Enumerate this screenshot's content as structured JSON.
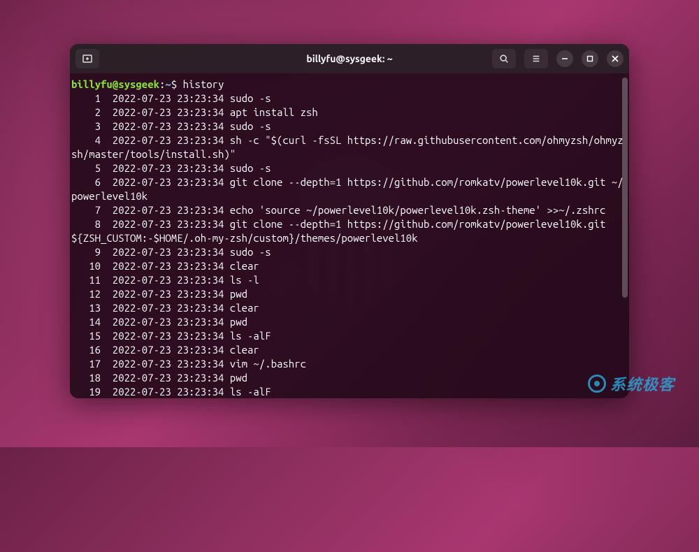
{
  "titlebar": {
    "title": "billyfu@sysgeek: ~"
  },
  "prompt": {
    "user_host": "billyfu@sysgeek",
    "colon": ":",
    "path": "~",
    "dollar": "$",
    "command": "history"
  },
  "history": [
    {
      "n": "1",
      "ts": "2022-07-23 23:23:34",
      "cmd": "sudo -s"
    },
    {
      "n": "2",
      "ts": "2022-07-23 23:23:34",
      "cmd": "apt install zsh"
    },
    {
      "n": "3",
      "ts": "2022-07-23 23:23:34",
      "cmd": "sudo -s"
    },
    {
      "n": "4",
      "ts": "2022-07-23 23:23:34",
      "cmd": "sh -c \"$(curl -fsSL https://raw.githubusercontent.com/ohmyzsh/ohmyzsh/master/tools/install.sh)\""
    },
    {
      "n": "5",
      "ts": "2022-07-23 23:23:34",
      "cmd": "sudo -s"
    },
    {
      "n": "6",
      "ts": "2022-07-23 23:23:34",
      "cmd": "git clone --depth=1 https://github.com/romkatv/powerlevel10k.git ~/powerlevel10k"
    },
    {
      "n": "7",
      "ts": "2022-07-23 23:23:34",
      "cmd": "echo 'source ~/powerlevel10k/powerlevel10k.zsh-theme' >>~/.zshrc"
    },
    {
      "n": "8",
      "ts": "2022-07-23 23:23:34",
      "cmd": "git clone --depth=1 https://github.com/romkatv/powerlevel10k.git ${ZSH_CUSTOM:-$HOME/.oh-my-zsh/custom}/themes/powerlevel10k"
    },
    {
      "n": "9",
      "ts": "2022-07-23 23:23:34",
      "cmd": "sudo -s"
    },
    {
      "n": "10",
      "ts": "2022-07-23 23:23:34",
      "cmd": "clear"
    },
    {
      "n": "11",
      "ts": "2022-07-23 23:23:34",
      "cmd": "ls -l"
    },
    {
      "n": "12",
      "ts": "2022-07-23 23:23:34",
      "cmd": "pwd"
    },
    {
      "n": "13",
      "ts": "2022-07-23 23:23:34",
      "cmd": "clear"
    },
    {
      "n": "14",
      "ts": "2022-07-23 23:23:34",
      "cmd": "pwd"
    },
    {
      "n": "15",
      "ts": "2022-07-23 23:23:34",
      "cmd": "ls -alF"
    },
    {
      "n": "16",
      "ts": "2022-07-23 23:23:34",
      "cmd": "clear"
    },
    {
      "n": "17",
      "ts": "2022-07-23 23:23:34",
      "cmd": "vim ~/.bashrc"
    },
    {
      "n": "18",
      "ts": "2022-07-23 23:23:34",
      "cmd": "pwd"
    },
    {
      "n": "19",
      "ts": "2022-07-23 23:23:34",
      "cmd": "ls -alF"
    }
  ],
  "watermark": {
    "text": "系统极客"
  }
}
